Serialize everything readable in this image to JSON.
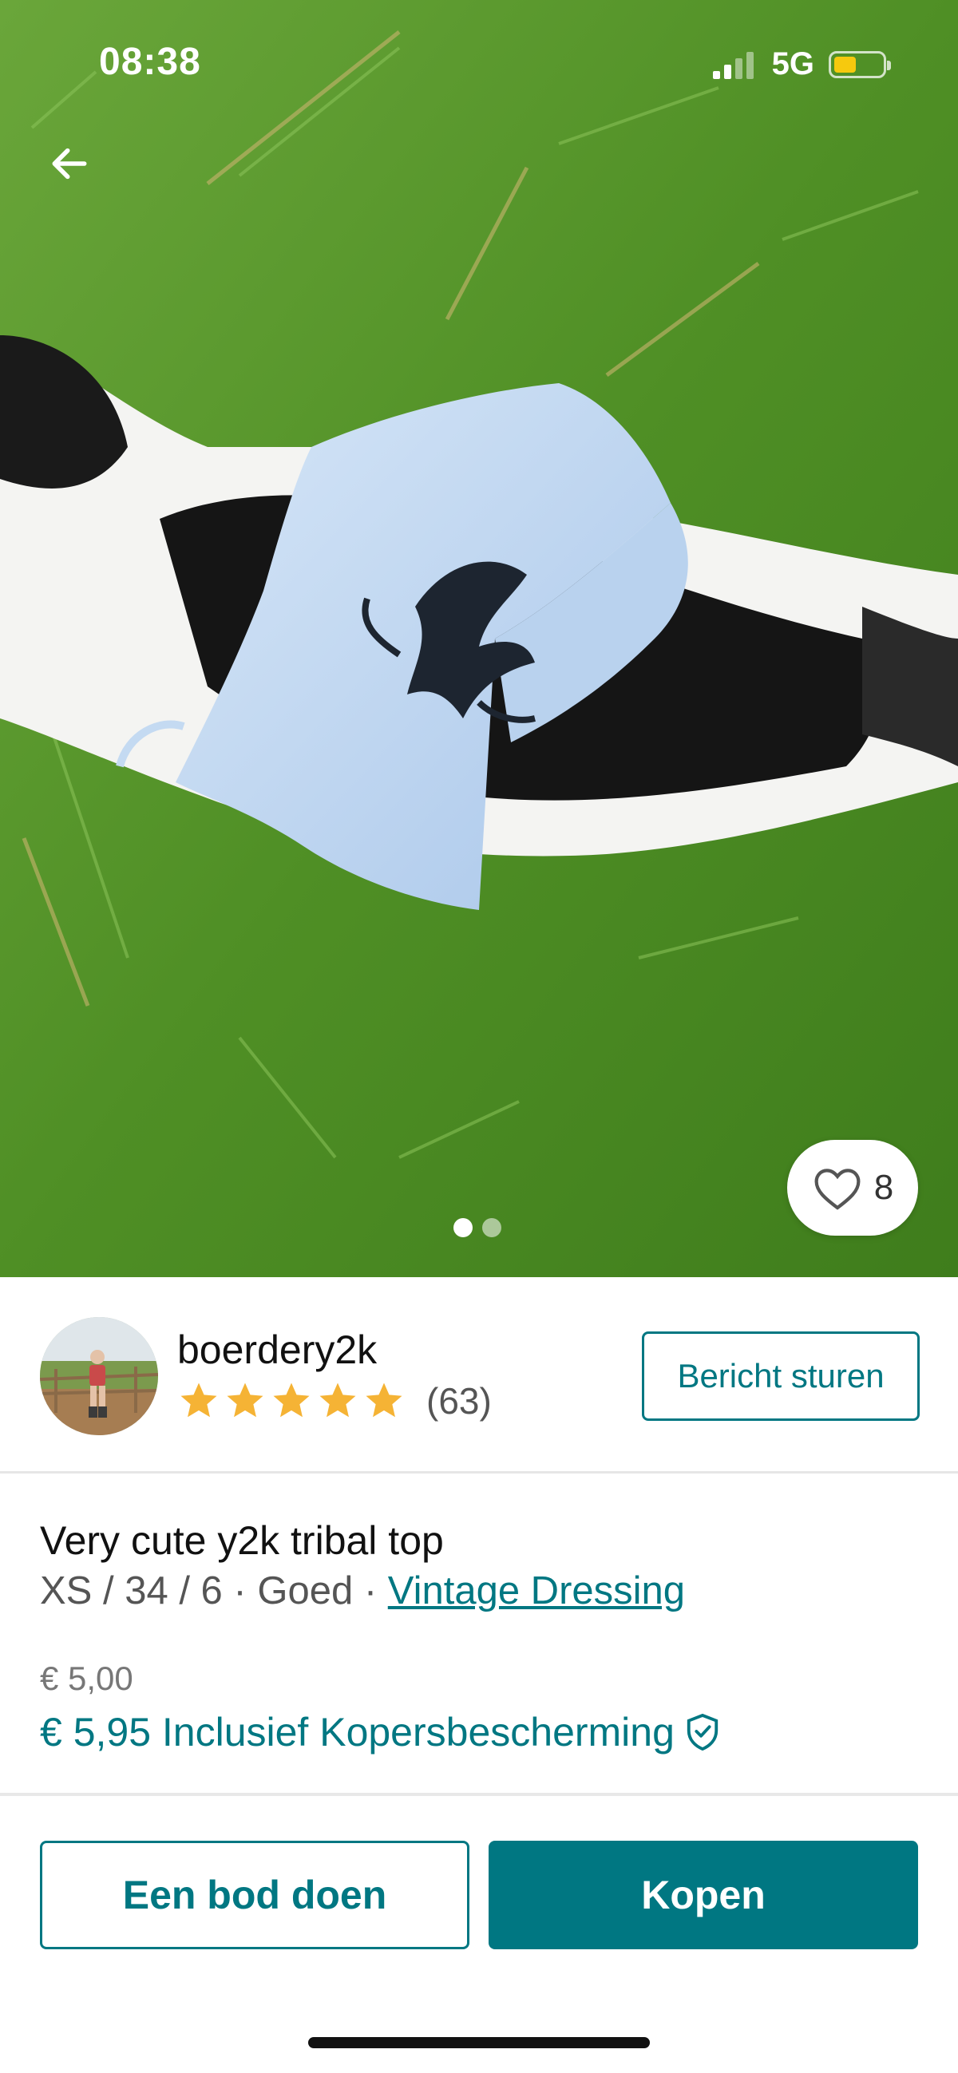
{
  "status_bar": {
    "time": "08:38",
    "network": "5G",
    "battery_level": 0.46
  },
  "gallery": {
    "image_count": 2,
    "active_index": 0,
    "image_icon": "product-photo-light-blue-top-on-bird"
  },
  "favorites": {
    "count": "8",
    "icon": "heart-outline-icon"
  },
  "seller": {
    "username": "boerdery2k",
    "rating_stars": 5,
    "review_count": "(63)",
    "message_button": "Bericht sturen"
  },
  "item": {
    "title": "Very cute y2k tribal top",
    "meta_prefix": "XS / 34 / 6 · Goed · ",
    "brand": "Vintage Dressing",
    "price": "€ 5,00",
    "price_with_protection": "€ 5,95 Inclusief Kopersbescherming"
  },
  "actions": {
    "offer_button": "Een bod doen",
    "buy_button": "Kopen"
  },
  "colors": {
    "accent": "#007782",
    "star": "#f5b335",
    "battery": "#f6c90e"
  }
}
